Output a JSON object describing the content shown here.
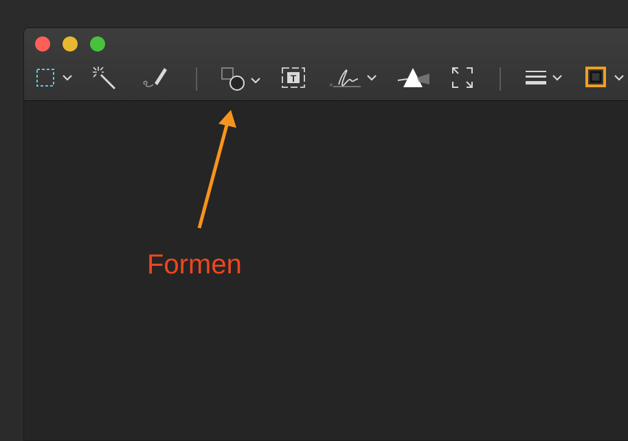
{
  "window": {
    "traffic_lights": [
      "close",
      "minimize",
      "zoom"
    ]
  },
  "toolbar": {
    "tools": [
      {
        "name": "rectangular-selection",
        "icon": "dashed-rect-icon",
        "has_menu": true
      },
      {
        "name": "instant-alpha",
        "icon": "magic-wand-icon",
        "has_menu": false
      },
      {
        "name": "sketch",
        "icon": "pen-sketch-icon",
        "has_menu": false
      },
      {
        "name": "shapes",
        "icon": "shapes-icon",
        "has_menu": true
      },
      {
        "name": "text",
        "icon": "text-box-icon",
        "has_menu": false
      },
      {
        "name": "sign",
        "icon": "signature-icon",
        "has_menu": true
      },
      {
        "name": "adjust-color",
        "icon": "prism-icon",
        "has_menu": false
      },
      {
        "name": "adjust-size",
        "icon": "resize-icon",
        "has_menu": false
      },
      {
        "name": "shape-style",
        "icon": "lines-icon",
        "has_menu": true
      },
      {
        "name": "border-color",
        "icon": "border-color-icon",
        "has_menu": true
      }
    ],
    "border_color": "#f0a020"
  },
  "annotation": {
    "label": "Formen",
    "label_color": "#f0461f",
    "arrow_color": "#f7941d"
  },
  "colors": {
    "selection_accent": "#5fc8e8",
    "icon": "#d8d8d8",
    "window_bg": "#252525"
  }
}
